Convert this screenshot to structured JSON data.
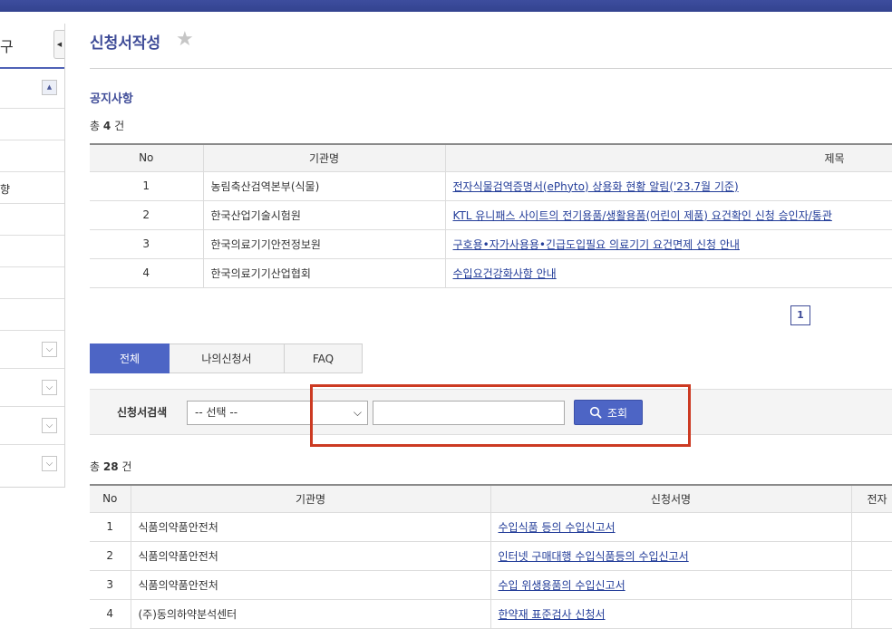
{
  "sidebar": {
    "header_text": "구",
    "collapse_glyph": "◀",
    "first_row_glyph": "▲",
    "items": [
      {
        "label": ""
      },
      {
        "label": ""
      },
      {
        "label": "향"
      },
      {
        "label": ""
      },
      {
        "label": ""
      },
      {
        "label": ""
      },
      {
        "label": ""
      }
    ],
    "sub_items": [
      {
        "glyph": "⌵"
      },
      {
        "glyph": "⌵"
      },
      {
        "glyph": "⌵"
      },
      {
        "glyph": "⌵"
      }
    ]
  },
  "page": {
    "title": "신청서작성",
    "star": "★"
  },
  "notices": {
    "section_title": "공지사항",
    "count_prefix": "총",
    "count": "4",
    "count_suffix": "건",
    "headers": [
      "No",
      "기관명",
      "제목"
    ],
    "rows": [
      {
        "no": "1",
        "org": "농림축산검역본부(식물)",
        "title": "전자식물검역증명서(ePhyto) 상용화 현황 알림('23.7월 기준)"
      },
      {
        "no": "2",
        "org": "한국산업기술시험원",
        "title": "KTL 유니패스 사이트의 전기용품/생활용품(어린이 제품) 요건확인 신청 승인자/통관"
      },
      {
        "no": "3",
        "org": "한국의료기기안전정보원",
        "title": "구호용•자가사용용•긴급도입필요 의료기기 요건면제 신청 안내"
      },
      {
        "no": "4",
        "org": "한국의료기기산업협회",
        "title": "수입요건강화사항 안내"
      }
    ],
    "page_number": "1"
  },
  "tabs": [
    {
      "label": "전체",
      "active": true
    },
    {
      "label": "나의신청서",
      "active": false
    },
    {
      "label": "FAQ",
      "active": false
    }
  ],
  "search": {
    "label": "신청서검색",
    "select_value": "-- 선택 --",
    "select_arrow": "⌵",
    "input_value": "",
    "button_label": "조회"
  },
  "forms": {
    "count_prefix": "총",
    "count": "28",
    "count_suffix": "건",
    "headers": [
      "No",
      "기관명",
      "신청서명",
      "전자"
    ],
    "rows": [
      {
        "no": "1",
        "org": "식품의약품안전처",
        "name": "수입식품 등의 수입신고서"
      },
      {
        "no": "2",
        "org": "식품의약품안전처",
        "name": "인터넷 구매대행 수입식품등의 수입신고서"
      },
      {
        "no": "3",
        "org": "식품의약품안전처",
        "name": "수입 위생용품의 수입신고서"
      },
      {
        "no": "4",
        "org": "(주)동의하약분석센터",
        "name": "한약재 표준검사 신청서"
      }
    ]
  },
  "colors": {
    "accent": "#4d65c5",
    "title": "#3f4c98",
    "link": "#233d99",
    "highlight": "#cc3a22",
    "topbar": "#33438f"
  }
}
